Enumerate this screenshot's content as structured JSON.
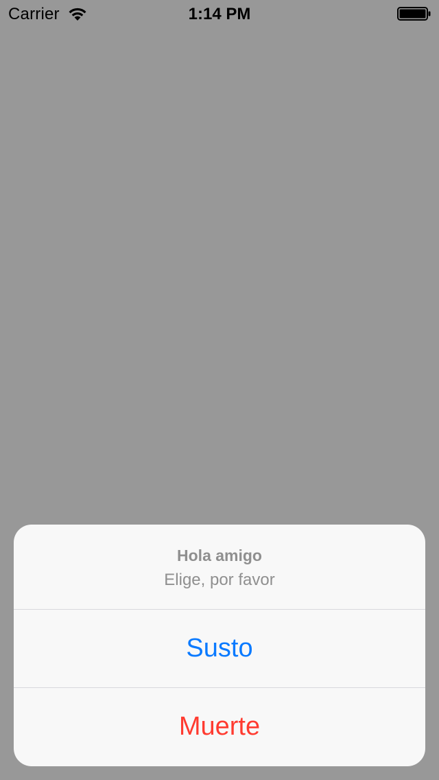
{
  "status_bar": {
    "carrier": "Carrier",
    "time": "1:14 PM",
    "wifi_icon": "wifi-icon",
    "battery_icon": "battery-icon",
    "battery_level": 1.0
  },
  "action_sheet": {
    "title": "Hola amigo",
    "message": "Elige, por favor",
    "buttons": [
      {
        "label": "Susto",
        "style": "default",
        "color": "#0a7aff"
      },
      {
        "label": "Muerte",
        "style": "destructive",
        "color": "#ff3b30"
      }
    ]
  },
  "colors": {
    "dimmed_background": "#989898",
    "sheet_background": "#f8f8f8",
    "header_text": "#8f8f8f"
  }
}
